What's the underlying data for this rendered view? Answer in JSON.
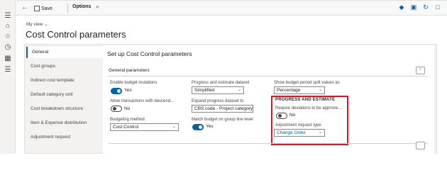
{
  "toolbar": {
    "save_label": "Save",
    "options_label": "Options"
  },
  "header": {
    "my_view": "My view",
    "title": "Cost Control parameters"
  },
  "tabs": [
    {
      "label": "General",
      "active": true
    },
    {
      "label": "Cost groups"
    },
    {
      "label": "Indirect cost template"
    },
    {
      "label": "Default category unit"
    },
    {
      "label": "Cost breakdown structure"
    },
    {
      "label": "Item & Expense distribution"
    },
    {
      "label": "Adjustment request"
    }
  ],
  "main": {
    "section_title": "Set up Cost Control parameters",
    "group_title": "General parameters",
    "enable_budget_mutations": {
      "label": "Enable budget mutations",
      "value": "Yes",
      "on": true
    },
    "allow_transactions": {
      "label": "Allow transactions with descend...",
      "value": "No",
      "on": false
    },
    "budgeting_method": {
      "label": "Budgeting method",
      "value": "Cost Control"
    },
    "progress_dataset": {
      "label": "Progress and estimate dataset",
      "value": "Simplified"
    },
    "expand_dataset": {
      "label": "Expand progress dataset to",
      "value": "CBS code - Project category"
    },
    "match_budget": {
      "label": "Match budget on group line level",
      "value": "Yes",
      "on": true
    },
    "show_period_split": {
      "label": "Show budget period split values as",
      "value": "Percentage"
    },
    "progress_estimate": {
      "title": "PROGRESS AND ESTIMATE",
      "require_deviations": {
        "label": "Require deviations to be approve...",
        "value": "No",
        "on": false
      },
      "adjustment_type": {
        "label": "Adjustment request type",
        "value": "Change Order"
      }
    }
  },
  "colors": {
    "accent": "#0063b1",
    "highlight": "#e81123"
  }
}
